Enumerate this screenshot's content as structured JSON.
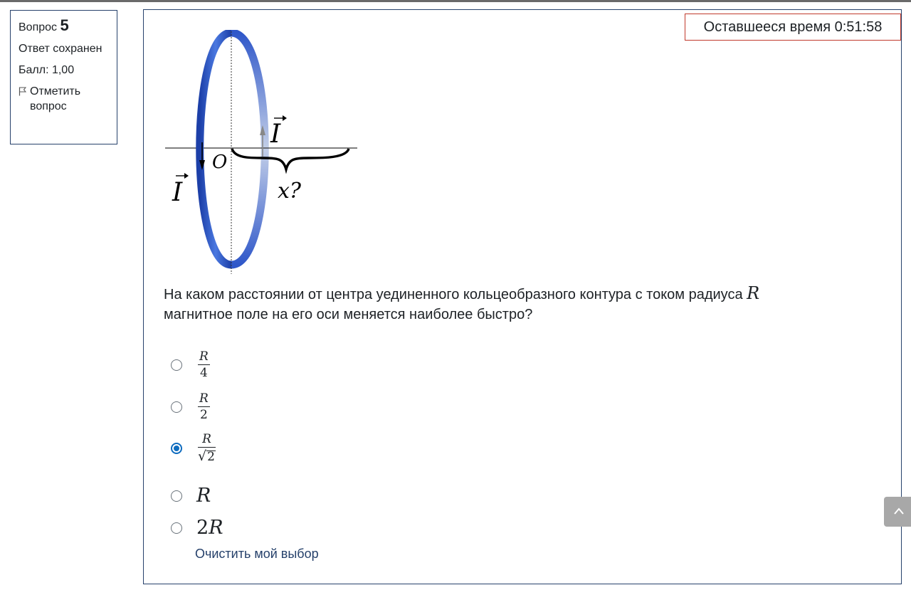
{
  "info": {
    "question_prefix": "Вопрос",
    "question_number": "5",
    "status": "Ответ сохранен",
    "grade": "Балл: 1,00",
    "flag_label": "Отметить вопрос"
  },
  "timer": {
    "label": "Оставшееся время 0:51:58"
  },
  "figure": {
    "current_label": "I",
    "origin_label": "O",
    "distance_label": "x?"
  },
  "question": {
    "text": "На каком расстоянии от центра уединенного кольцеобразного контура с током радиуса",
    "text_line2": "магнитное поле на его оси меняется наиболее быстро?",
    "radius_symbol": "R"
  },
  "options": [
    {
      "type": "fraction",
      "numerator": "R",
      "denominator": "4",
      "checked": false
    },
    {
      "type": "fraction",
      "numerator": "R",
      "denominator": "2",
      "checked": false
    },
    {
      "type": "fraction-sqrt",
      "numerator": "R",
      "denominator": "2",
      "checked": true
    },
    {
      "type": "plain",
      "prefix": "",
      "symbol": "R",
      "checked": false
    },
    {
      "type": "plain",
      "prefix": "2",
      "symbol": "R",
      "checked": false
    }
  ],
  "clear_label": "Очистить мой выбор",
  "colors": {
    "border": "#26416b",
    "timer_border": "#c0392b",
    "accent": "#0f6cbf",
    "ring": "#2a4fb8"
  },
  "icons": {
    "flag": "flag-icon",
    "scroll_top": "arrow-up-icon"
  }
}
